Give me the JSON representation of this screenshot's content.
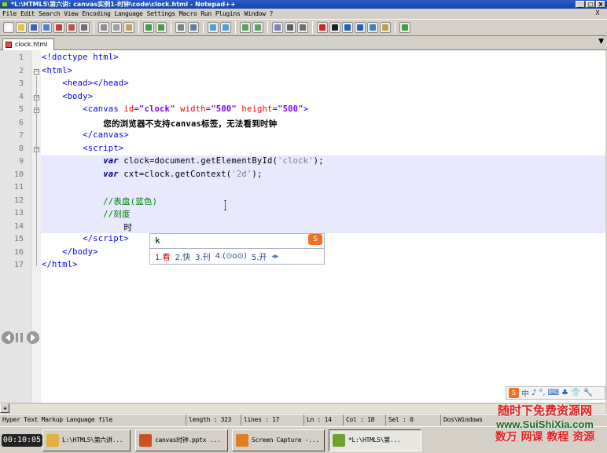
{
  "window": {
    "title": "*L:\\HTML5\\第六讲: canvas实例1-时钟\\code\\clock.html - Notepad++",
    "controls": [
      "_",
      "□",
      "X"
    ]
  },
  "menu": [
    "File",
    "Edit",
    "Search",
    "View",
    "Encoding",
    "Language",
    "Settings",
    "Macro",
    "Run",
    "Plugins",
    "Window",
    "?"
  ],
  "menu_close": "X",
  "toolbar": {
    "icons": [
      "new-file-icon",
      "open-file-icon",
      "save-icon",
      "save-all-icon",
      "close-icon",
      "close-all-icon",
      "print-icon",
      "cut-icon",
      "copy-icon",
      "paste-icon",
      "undo-icon",
      "redo-icon",
      "find-icon",
      "replace-icon",
      "zoom-in-icon",
      "zoom-out-icon",
      "sync-v-icon",
      "sync-h-icon",
      "word-wrap-icon",
      "show-all-chars-icon",
      "indent-guide-icon",
      "record-macro-icon",
      "stop-macro-icon",
      "play-macro-icon",
      "run-macro-multiple-icon",
      "save-macro-icon",
      "trim-icon",
      "spellcheck-icon"
    ]
  },
  "tab": {
    "label": "clock.html",
    "dropdown": "▼"
  },
  "editor": {
    "lines": [
      {
        "n": "1",
        "html": "<span class=\"tag\">&lt;!doctype html&gt;</span>"
      },
      {
        "n": "2",
        "html": "<span class=\"tag\">&lt;html&gt;</span>"
      },
      {
        "n": "3",
        "html": "    <span class=\"tag\">&lt;head&gt;&lt;/head&gt;</span>"
      },
      {
        "n": "4",
        "html": "    <span class=\"tag\">&lt;body&gt;</span>"
      },
      {
        "n": "5",
        "html": "        <span class=\"tag\">&lt;canvas</span> <span class=\"attr\">id</span><span class=\"tag\">=</span><span class=\"str\">\"clock\"</span> <span class=\"attr\">width</span><span class=\"tag\">=</span><span class=\"str\">\"500\"</span> <span class=\"attr\">height</span><span class=\"tag\">=</span><span class=\"str\">\"500\"</span><span class=\"tag\">&gt;</span>"
      },
      {
        "n": "6",
        "html": "            <span class=\"txt\">您的浏览器不支持canvas标签，无法看到时钟</span>"
      },
      {
        "n": "7",
        "html": "        <span class=\"tag\">&lt;/canvas&gt;</span>"
      },
      {
        "n": "8",
        "html": "        <span class=\"tag\">&lt;script&gt;</span>"
      },
      {
        "n": "9",
        "html": "            <span class=\"kw\">var</span> clock=document.getElementById(<span class=\"sq\">'clock'</span>);"
      },
      {
        "n": "10",
        "html": "            <span class=\"kw\">var</span> cxt=clock.getContext(<span class=\"sq\">'2d'</span>);"
      },
      {
        "n": "11",
        "html": ""
      },
      {
        "n": "12",
        "html": "            <span class=\"cmt\">//表盘(蓝色)</span>"
      },
      {
        "n": "13",
        "html": "            <span class=\"cmt\">//刻度</span>"
      },
      {
        "n": "14",
        "html": "                时"
      },
      {
        "n": "15",
        "html": "        <span class=\"tag\">&lt;/script&gt;</span>"
      },
      {
        "n": "16",
        "html": "    <span class=\"tag\">&lt;/body&gt;</span>"
      },
      {
        "n": "17",
        "html": "<span class=\"tag\">&lt;/html&gt;</span>"
      }
    ]
  },
  "ime": {
    "composition": "k",
    "logo": "S",
    "candidates": [
      "1.看",
      "2.快",
      "3.刊",
      "4.(⊙o⊙)",
      "5.开"
    ],
    "pager": "◂▸"
  },
  "ime_toolbar": {
    "logo": "S",
    "items": [
      "中",
      "♪",
      "°,",
      "⌨",
      "♣",
      "👕",
      "🔧"
    ]
  },
  "status": {
    "language": "Hyper Text Markup Language file",
    "length": "length : 323",
    "lines": "lines : 17",
    "ln": "Ln : 14",
    "col": "Col : 18",
    "sel": "Sel : 0",
    "eol": "Dos\\Windows"
  },
  "taskbar": {
    "time": "00:10:05",
    "tasks": [
      {
        "label": "L:\\HTML5\\第六讲...",
        "color": "#e0b040"
      },
      {
        "label": "canvas时钟.pptx ...",
        "color": "#d05020"
      },
      {
        "label": "Screen Capture -...",
        "color": "#e08020"
      },
      {
        "label": "*L:\\HTML5\\第...",
        "color": "#70a030"
      }
    ]
  },
  "watermark": {
    "line1": "随时下免费资源网",
    "line2": "www.SuiShiXia.com",
    "line3": "数万 网课 教程 资源"
  }
}
